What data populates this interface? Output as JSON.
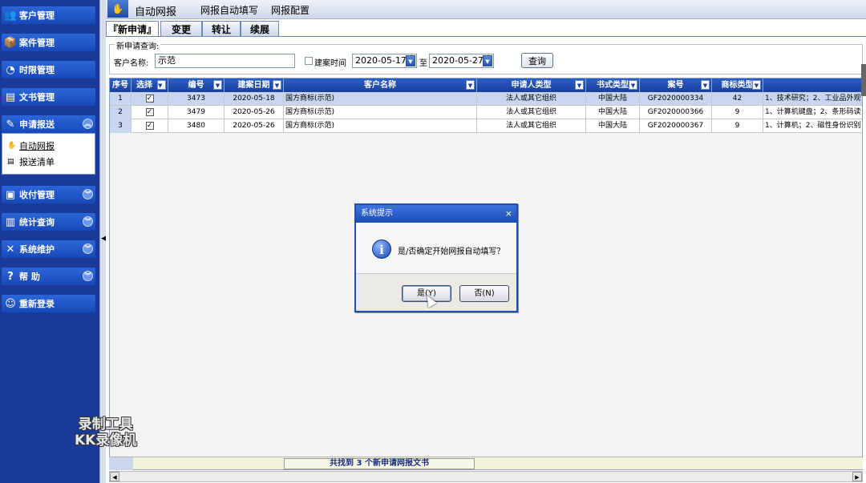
{
  "sidebar": {
    "items": [
      {
        "label": "客户管理",
        "icon": "clients-icon"
      },
      {
        "label": "案件管理",
        "icon": "cases-icon"
      },
      {
        "label": "时限管理",
        "icon": "clock-icon"
      },
      {
        "label": "文书管理",
        "icon": "document-icon"
      },
      {
        "label": "申请报送",
        "icon": "pencil-icon"
      },
      {
        "label": "收付管理",
        "icon": "payment-icon"
      },
      {
        "label": "统计查询",
        "icon": "stats-icon"
      },
      {
        "label": "系统维护",
        "icon": "tools-icon"
      },
      {
        "label": "帮 助",
        "icon": "help-icon"
      },
      {
        "label": "重新登录",
        "icon": "relogin-icon"
      }
    ],
    "subitems": [
      {
        "label": "自动网报",
        "icon": "hand-icon"
      },
      {
        "label": "报送清单",
        "icon": "list-icon"
      }
    ]
  },
  "topbar": {
    "title": "自动网报",
    "menu1": "网报自动填写",
    "menu2": "网报配置"
  },
  "tabs": [
    {
      "label": "『新申请』",
      "active": true
    },
    {
      "label": "变更",
      "active": false
    },
    {
      "label": "转让",
      "active": false
    },
    {
      "label": "续展",
      "active": false
    }
  ],
  "query": {
    "legend": "新申请查询:",
    "client_label": "客户名称:",
    "client_value": "示范",
    "date_check_label": "建案时间",
    "date_from": "2020-05-17",
    "date_to_label": "至",
    "date_to": "2020-05-27",
    "query_button": "查询"
  },
  "table": {
    "columns": [
      "序号",
      "选择",
      "编号",
      "建案日期",
      "客户名称",
      "申请人类型",
      "书式类型",
      "案号",
      "商标类型",
      ""
    ],
    "rows": [
      {
        "seq": "1",
        "checked": true,
        "num": "3473",
        "date": "2020-05-18",
        "client": "国方商标(示范)",
        "applicant": "法人或其它组织",
        "format": "中国大陆",
        "case": "GF2020000334",
        "tm": "42",
        "goods": "1、技术研究；2、工业品外观"
      },
      {
        "seq": "2",
        "checked": true,
        "num": "3479",
        "date": "2020-05-26",
        "client": "国方商标(示范)",
        "applicant": "法人或其它组织",
        "format": "中国大陆",
        "case": "GF2020000366",
        "tm": "9",
        "goods": "1、计算机键盘；2、条形码读"
      },
      {
        "seq": "3",
        "checked": true,
        "num": "3480",
        "date": "2020-05-26",
        "client": "国方商标(示范)",
        "applicant": "法人或其它组织",
        "format": "中国大陆",
        "case": "GF2020000367",
        "tm": "9",
        "goods": "1、计算机；2、磁性身份识别"
      }
    ]
  },
  "footer": {
    "message": "共找到 3 个新申请网报文书"
  },
  "dialog": {
    "title": "系统提示",
    "close": "×",
    "message": "是/否确定开始网报自动填写？",
    "yes": "是(Y)",
    "no": "否(N)",
    "info": "i"
  },
  "watermark": {
    "line1": "录制工具",
    "line2": "KK录像机"
  }
}
